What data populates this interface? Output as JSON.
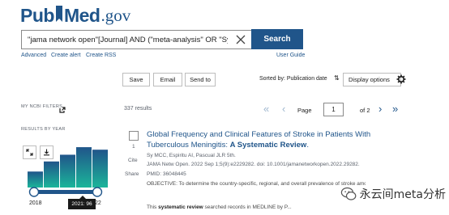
{
  "header": {
    "logo_pub": "Pub",
    "logo_med": "Med",
    "logo_gov": ".gov"
  },
  "search": {
    "query": "\"jama network open\"[Journal] AND (\"meta-analysis\" OR \"Systematic Rev",
    "button_label": "Search"
  },
  "sublinks": {
    "advanced": "Advanced",
    "create_alert": "Create alert",
    "create_rss": "Create RSS",
    "user_guide": "User Guide"
  },
  "actions": {
    "save": "Save",
    "email": "Email",
    "send_to": "Send to",
    "sort_label": "Sorted by: Publication date",
    "display_options": "Display options"
  },
  "sidebar": {
    "my_filters": "MY NCBI FILTERS",
    "results_by_year": "RESULTS BY YEAR",
    "year_start": "2018",
    "year_end": "22",
    "tooltip": "2021: 96"
  },
  "chart_data": {
    "type": "bar",
    "categories": [
      "2018",
      "2019",
      "2020",
      "2021",
      "2022"
    ],
    "values": [
      38,
      62,
      78,
      96,
      90
    ],
    "ylim": [
      0,
      100
    ],
    "grid": false,
    "highlight_color": "#20558a",
    "bar_color": "#1d9a8d"
  },
  "pagination": {
    "page_label": "Page",
    "current_page": "1",
    "of_label": "of 2",
    "results_count": "337 results"
  },
  "result": {
    "number": "1",
    "cite": "Cite",
    "share": "Share",
    "title_part1": "Global Frequency and Clinical Features of Stroke in Patients With Tuberculous Meningitis: ",
    "title_bold": "A Systematic Review",
    "title_end": ".",
    "authors": "Sy MCC, Espiritu AI, Pascual JLR 5th.",
    "journal": "JAMA Netw Open. 2022 Sep 1;5(9):e2229282. doi: 10.1001/jamanetworkopen.2022.29282.",
    "pmid": "PMID: 36048445",
    "abstract": "OBJECTIVE: To determine the country-specific, regional, and overall prevalence of stroke among patients with TBM, including their clinical manifestations, stroke locations, and outcomes.",
    "snippet_pre": "This ",
    "snippet_bold": "systematic review",
    "snippet_post": " searched records in MEDLINE by P..."
  },
  "watermark": {
    "text": "永云间meta分析"
  }
}
